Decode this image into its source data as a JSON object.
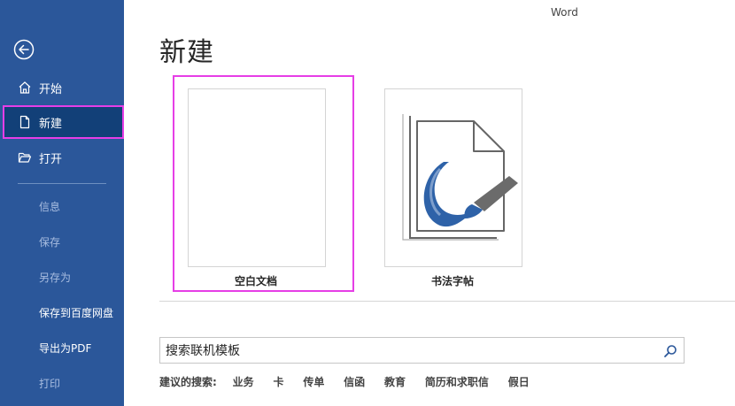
{
  "app": {
    "title": "Word"
  },
  "sidebar": {
    "back_label": "",
    "items": [
      {
        "label": "开始",
        "icon": "home-icon"
      },
      {
        "label": "新建",
        "icon": "new-document-icon",
        "selected": true
      },
      {
        "label": "打开",
        "icon": "open-folder-icon"
      }
    ],
    "sub_items": [
      {
        "label": "信息",
        "enabled": false
      },
      {
        "label": "保存",
        "enabled": false
      },
      {
        "label": "另存为",
        "enabled": false
      },
      {
        "label": "保存到百度网盘",
        "enabled": true
      },
      {
        "label": "导出为PDF",
        "enabled": true
      },
      {
        "label": "打印",
        "enabled": false
      }
    ]
  },
  "main": {
    "page_title": "新建",
    "templates": [
      {
        "label": "空白文档",
        "selected": true
      },
      {
        "label": "书法字帖"
      }
    ],
    "search": {
      "placeholder": "搜索联机模板",
      "value": ""
    },
    "suggested": {
      "label": "建议的搜索:",
      "tags": [
        "业务",
        "卡",
        "传单",
        "信函",
        "教育",
        "简历和求职信",
        "假日"
      ]
    }
  },
  "colors": {
    "sidebar_bg": "#2b579a",
    "sidebar_selected": "#124078",
    "highlight": "#e63ee6",
    "calligraphy_blue": "#2e62a8"
  }
}
